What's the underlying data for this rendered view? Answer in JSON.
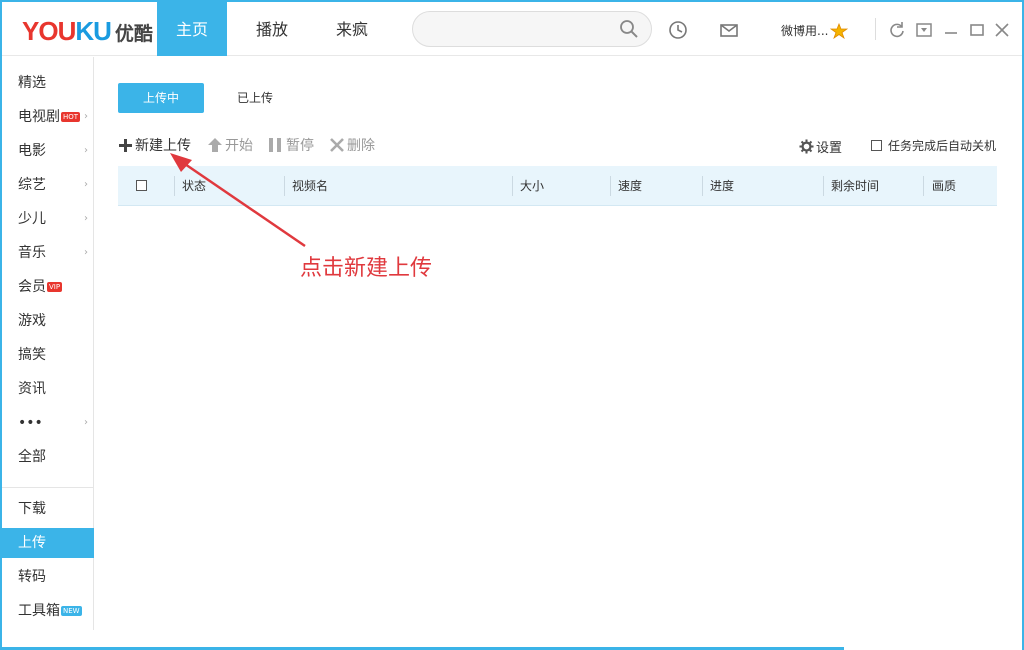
{
  "header": {
    "logo_en_you": "YOU",
    "logo_en_ku": "KU",
    "logo_cn": "优酷",
    "nav": [
      "主页",
      "播放",
      "来疯"
    ],
    "user_name": "微博用..."
  },
  "sidebar": {
    "items": [
      {
        "label": "精选",
        "chevron": ""
      },
      {
        "label": "电视剧",
        "badge": "HOT",
        "chevron": "›"
      },
      {
        "label": "电影",
        "chevron": "›"
      },
      {
        "label": "综艺",
        "chevron": "›"
      },
      {
        "label": "少儿",
        "chevron": "›"
      },
      {
        "label": "音乐",
        "chevron": "›"
      },
      {
        "label": "会员",
        "badge": "VIP",
        "chevron": ""
      },
      {
        "label": "游戏",
        "chevron": ""
      },
      {
        "label": "搞笑",
        "chevron": ""
      },
      {
        "label": "资讯",
        "chevron": ""
      },
      {
        "label": "•••",
        "chevron": "›"
      },
      {
        "label": "全部",
        "chevron": ""
      }
    ],
    "tools": [
      {
        "label": "下载"
      },
      {
        "label": "上传"
      },
      {
        "label": "转码"
      },
      {
        "label": "工具箱",
        "badge": "NEW"
      }
    ]
  },
  "tabs": {
    "uploading": "上传中",
    "uploaded": "已上传"
  },
  "toolbar": {
    "new_upload": "新建上传",
    "start": "开始",
    "pause": "暂停",
    "delete": "删除",
    "settings": "设置",
    "auto_shutdown": "任务完成后自动关机"
  },
  "table": {
    "columns": [
      "状态",
      "视频名",
      "大小",
      "速度",
      "进度",
      "剩余时间",
      "画质"
    ]
  },
  "annotation": "点击新建上传",
  "colors": {
    "accent": "#3bb4e8",
    "annotation": "#e0393e",
    "logo_red": "#e8362e",
    "logo_blue": "#1a9be0"
  }
}
